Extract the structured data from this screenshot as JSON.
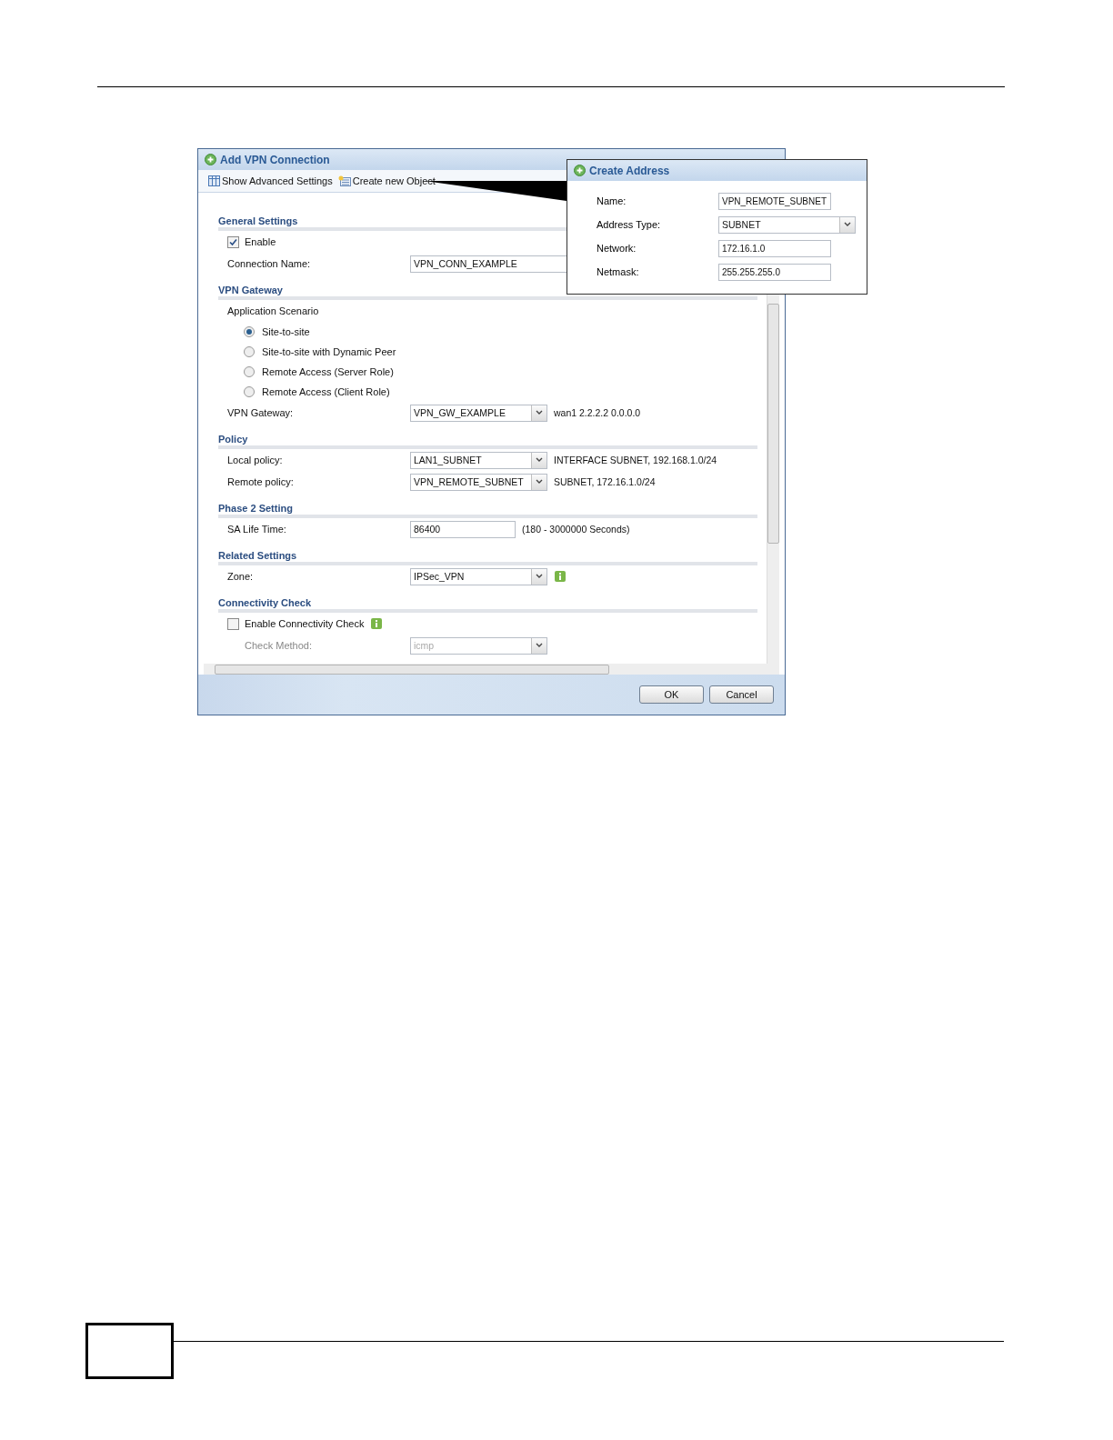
{
  "dialog": {
    "title": "Add VPN Connection",
    "toolbar": [
      {
        "kind": "settings",
        "label": "Show Advanced Settings"
      },
      {
        "kind": "object",
        "label": "Create new Object"
      }
    ],
    "sections": [
      {
        "title": "General Settings",
        "rows": [
          {
            "kind": "checkbox",
            "label": "Enable",
            "checked": true
          },
          {
            "kind": "text",
            "label": "Connection Name:",
            "value": "VPN_CONN_EXAMPLE"
          }
        ]
      },
      {
        "title": "VPN Gateway",
        "rows": [
          {
            "kind": "radio-group",
            "label": "Application Scenario",
            "options": [
              {
                "label": "Site-to-site",
                "selected": true
              },
              {
                "label": "Site-to-site with Dynamic Peer",
                "selected": false
              },
              {
                "label": "Remote Access (Server Role)",
                "selected": false
              },
              {
                "label": "Remote Access (Client Role)",
                "selected": false
              }
            ]
          },
          {
            "kind": "select",
            "label": "VPN Gateway:",
            "value": "VPN_GW_EXAMPLE",
            "note": "wan1 2.2.2.2 0.0.0.0"
          }
        ]
      },
      {
        "title": "Policy",
        "rows": [
          {
            "kind": "select",
            "label": "Local policy:",
            "value": "LAN1_SUBNET",
            "note": "INTERFACE SUBNET, 192.168.1.0/24"
          },
          {
            "kind": "select",
            "label": "Remote policy:",
            "value": "VPN_REMOTE_SUBNET",
            "note": "SUBNET, 172.16.1.0/24"
          }
        ]
      },
      {
        "title": "Phase 2 Setting",
        "rows": [
          {
            "kind": "text",
            "label": "SA Life Time:",
            "value": "86400",
            "note": "(180 - 3000000 Seconds)"
          }
        ]
      },
      {
        "title": "Related Settings",
        "rows": [
          {
            "kind": "select",
            "label": "Zone:",
            "value": "IPSec_VPN",
            "info": true
          }
        ]
      },
      {
        "title": "Connectivity Check",
        "rows": [
          {
            "kind": "checkbox",
            "label": "Enable Connectivity Check",
            "checked": false,
            "info": true
          },
          {
            "kind": "select",
            "label": "Check Method:",
            "value": "icmp",
            "disabled": true
          }
        ]
      }
    ],
    "buttons": [
      "OK",
      "Cancel"
    ]
  },
  "popup": {
    "title": "Create Address",
    "fields": [
      {
        "kind": "text",
        "label": "Name:",
        "value": "VPN_REMOTE_SUBNET"
      },
      {
        "kind": "select",
        "label": "Address Type:",
        "value": "SUBNET"
      },
      {
        "kind": "text",
        "label": "Network:",
        "value": "172.16.1.0"
      },
      {
        "kind": "text",
        "label": "Netmask:",
        "value": "255.255.255.0"
      }
    ]
  }
}
